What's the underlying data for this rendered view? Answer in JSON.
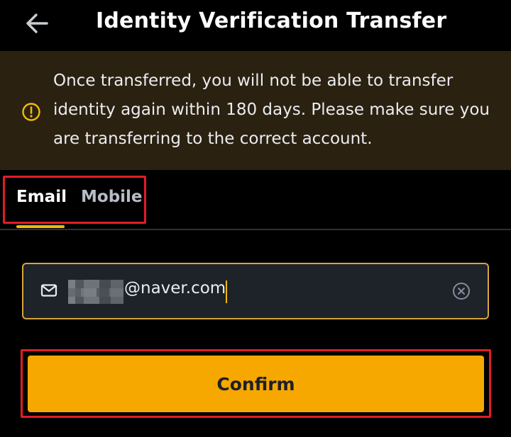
{
  "header": {
    "back_icon": "arrow-left-icon",
    "title": "Identity Verification Transfer"
  },
  "banner": {
    "icon": "warning-circle-icon",
    "text": "Once transferred, you will not be able to transfer identity again within 180 days. Please make sure you are transferring to the correct account."
  },
  "tabs": {
    "items": [
      {
        "label": "Email",
        "active": true
      },
      {
        "label": "Mobile",
        "active": false
      }
    ]
  },
  "email_field": {
    "icon": "mail-icon",
    "value_visible": "@naver.com",
    "clear_icon": "clear-circle-icon"
  },
  "confirm": {
    "label": "Confirm"
  },
  "colors": {
    "background": "#000000",
    "banner": "#2b2111",
    "accent": "#f0b90b",
    "button": "#f6a700",
    "highlight_frame": "#e11d26"
  }
}
